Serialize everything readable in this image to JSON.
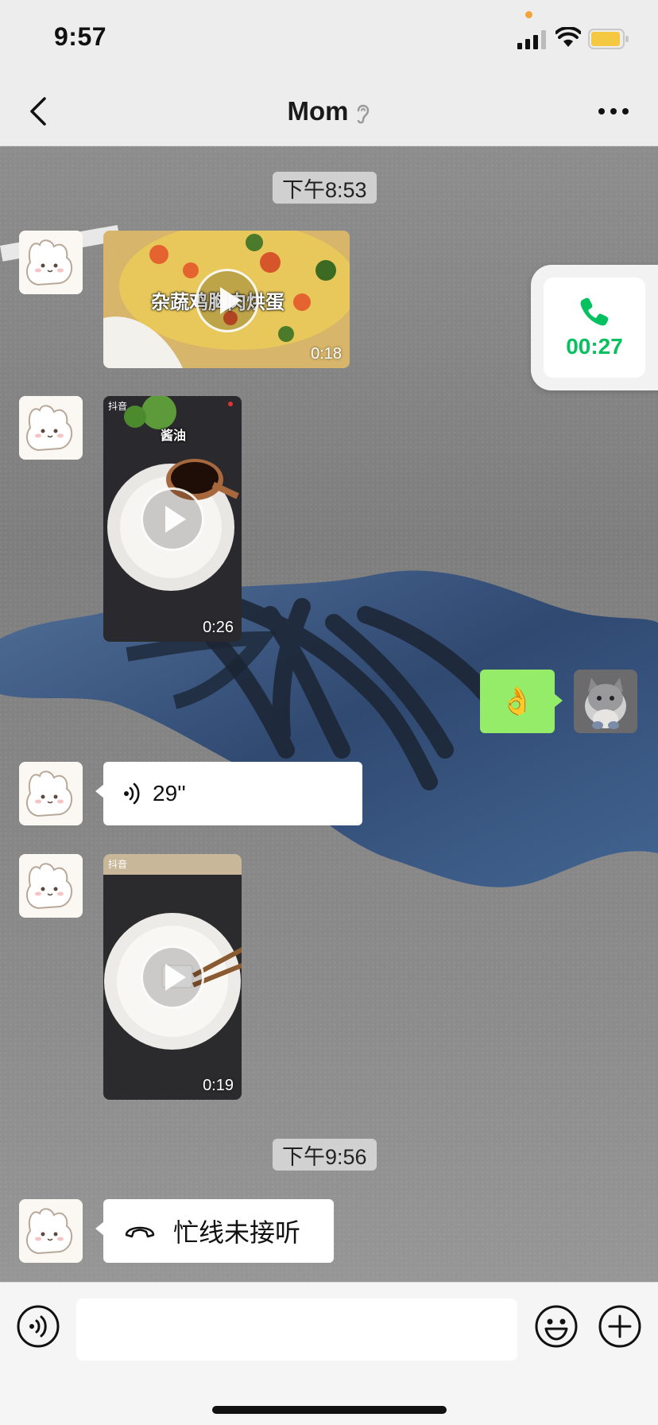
{
  "status_bar": {
    "time": "9:57"
  },
  "nav": {
    "title": "Mom",
    "back_icon": "chevron-left-icon",
    "ear_icon": "ear-icon",
    "more_icon": "more-dots-icon"
  },
  "timestamps": [
    "下午8:53",
    "下午9:56"
  ],
  "messages": {
    "video_1": {
      "caption": "杂蔬鸡胸肉烘蛋",
      "duration": "0:18"
    },
    "video_2": {
      "caption": "酱油",
      "duration": "0:26",
      "watermark": "抖音"
    },
    "sticker_reply": {
      "emoji": "👌"
    },
    "voice_message": {
      "duration": "29''"
    },
    "video_3": {
      "duration": "0:19",
      "watermark": "抖音"
    },
    "missed_call": {
      "text": "忙线未接听"
    }
  },
  "call_float": {
    "duration": "00:27"
  },
  "colors": {
    "wechat_green": "#95ec69",
    "call_green": "#07c160",
    "background": "#ededed"
  }
}
